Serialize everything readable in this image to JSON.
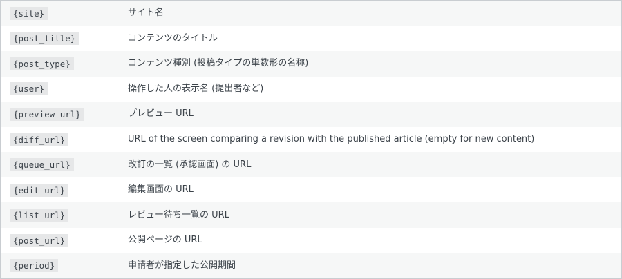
{
  "table": {
    "rows": [
      {
        "placeholder": "{site}",
        "description": "サイト名"
      },
      {
        "placeholder": "{post_title}",
        "description": "コンテンツのタイトル"
      },
      {
        "placeholder": "{post_type}",
        "description": "コンテンツ種別 (投稿タイプの単数形の名称)"
      },
      {
        "placeholder": "{user}",
        "description": "操作した人の表示名 (提出者など)"
      },
      {
        "placeholder": "{preview_url}",
        "description": "プレビュー URL"
      },
      {
        "placeholder": "{diff_url}",
        "description": "URL of the screen comparing a revision with the published article (empty for new content)"
      },
      {
        "placeholder": "{queue_url}",
        "description": "改訂の一覧 (承認画面) の URL"
      },
      {
        "placeholder": "{edit_url}",
        "description": "編集画面の URL"
      },
      {
        "placeholder": "{list_url}",
        "description": "レビュー待ち一覧の URL"
      },
      {
        "placeholder": "{post_url}",
        "description": "公開ページの URL"
      },
      {
        "placeholder": "{period}",
        "description": "申請者が指定した公開期間"
      }
    ]
  }
}
